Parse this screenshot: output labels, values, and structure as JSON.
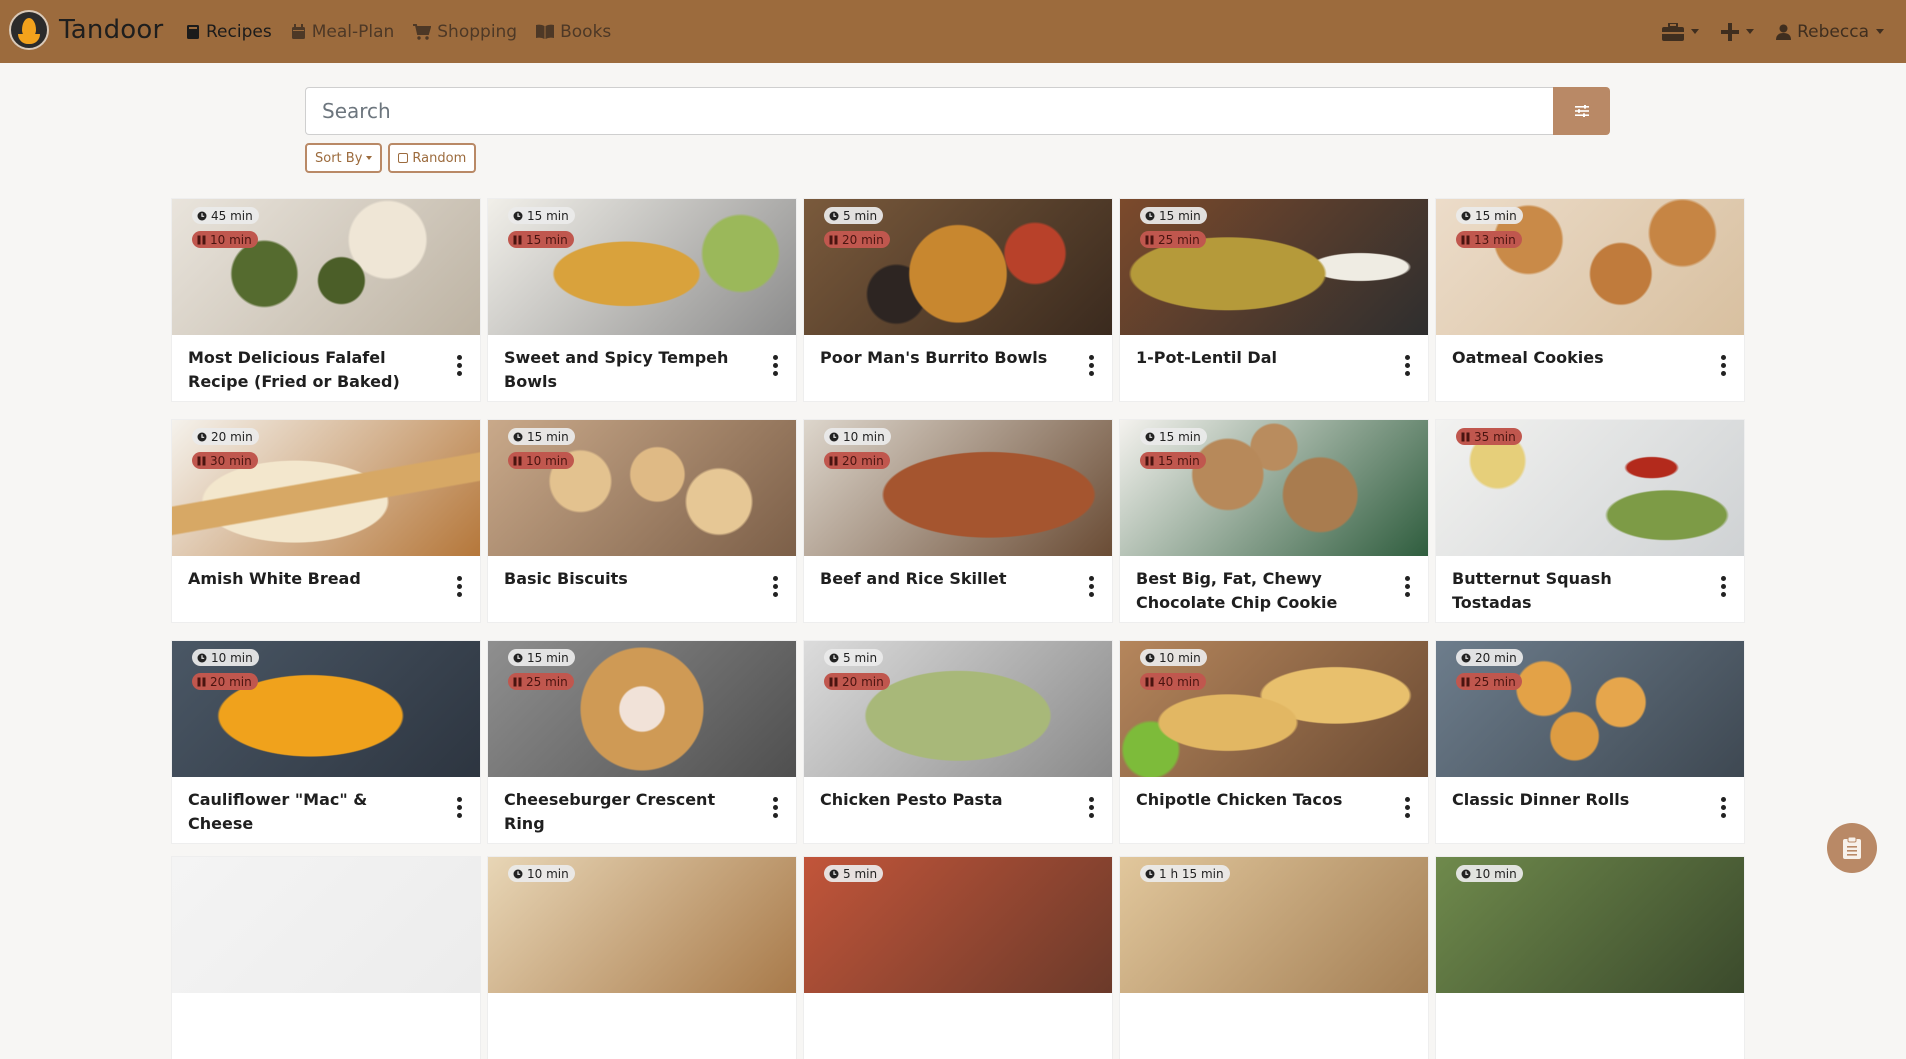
{
  "app": {
    "name": "Tandoor"
  },
  "nav": {
    "links": [
      {
        "label": "Recipes",
        "icon": "book-icon",
        "active": true
      },
      {
        "label": "Meal-Plan",
        "icon": "calendar-icon",
        "active": false
      },
      {
        "label": "Shopping",
        "icon": "cart-icon",
        "active": false
      },
      {
        "label": "Books",
        "icon": "book-open-icon",
        "active": false
      }
    ],
    "user": "Rebecca"
  },
  "search": {
    "placeholder": "Search",
    "value": ""
  },
  "buttons": {
    "sort": "Sort By",
    "random": "Random"
  },
  "colors": {
    "navbar": "#9c6b3d",
    "accent": "#b98966",
    "waiting_badge": "#c0574e",
    "working_badge": "#ebebeb"
  },
  "recipes": [
    {
      "title": "Most Delicious Falafel Recipe (Fried or Baked)",
      "working": "45 min",
      "waiting": "10 min"
    },
    {
      "title": "Sweet and Spicy Tempeh Bowls",
      "working": "15 min",
      "waiting": "15 min"
    },
    {
      "title": "Poor Man's Burrito Bowls",
      "working": "5 min",
      "waiting": "20 min"
    },
    {
      "title": "1-Pot-Lentil Dal",
      "working": "15 min",
      "waiting": "25 min"
    },
    {
      "title": "Oatmeal Cookies",
      "working": "15 min",
      "waiting": "13 min"
    },
    {
      "title": "Amish White Bread",
      "working": "20 min",
      "waiting": "30 min"
    },
    {
      "title": "Basic Biscuits",
      "working": "15 min",
      "waiting": "10 min"
    },
    {
      "title": "Beef and Rice Skillet",
      "working": "10 min",
      "waiting": "20 min"
    },
    {
      "title": "Best Big, Fat, Chewy Chocolate Chip Cookie",
      "working": "15 min",
      "waiting": "15 min"
    },
    {
      "title": "Butternut Squash Tostadas",
      "working": "",
      "waiting": "35 min"
    },
    {
      "title": "Cauliflower \"Mac\" & Cheese",
      "working": "10 min",
      "waiting": "20 min"
    },
    {
      "title": "Cheeseburger Crescent Ring",
      "working": "15 min",
      "waiting": "25 min"
    },
    {
      "title": "Chicken Pesto Pasta",
      "working": "5 min",
      "waiting": "20 min"
    },
    {
      "title": "Chipotle Chicken Tacos",
      "working": "10 min",
      "waiting": "40 min"
    },
    {
      "title": "Classic Dinner Rolls",
      "working": "20 min",
      "waiting": "25 min"
    },
    {
      "title": "",
      "working": "",
      "waiting": ""
    },
    {
      "title": "",
      "working": "10 min",
      "waiting": ""
    },
    {
      "title": "",
      "working": "5 min",
      "waiting": ""
    },
    {
      "title": "",
      "working": "1 h 15 min",
      "waiting": ""
    },
    {
      "title": "",
      "working": "10 min",
      "waiting": ""
    }
  ]
}
